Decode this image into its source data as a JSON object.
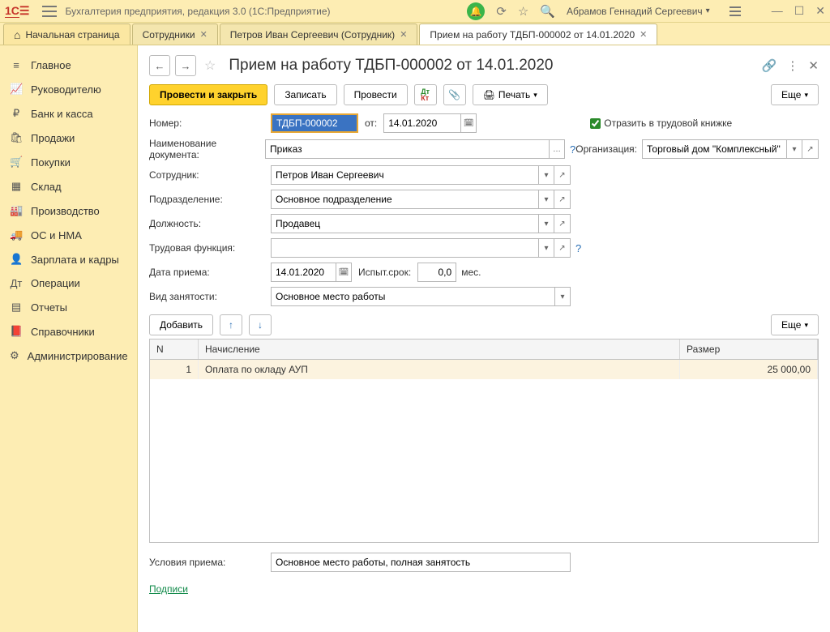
{
  "titlebar": {
    "app_title": "Бухгалтерия предприятия, редакция 3.0  (1С:Предприятие)",
    "username": "Абрамов Геннадий Сергеевич"
  },
  "tabs": {
    "home": "Начальная страница",
    "t1": "Сотрудники",
    "t2": "Петров Иван Сергеевич (Сотрудник)",
    "t3": "Прием на работу ТДБП-000002 от 14.01.2020"
  },
  "sidebar": {
    "items": [
      {
        "icon": "≡",
        "label": "Главное"
      },
      {
        "icon": "📈",
        "label": "Руководителю"
      },
      {
        "icon": "₽",
        "label": "Банк и касса"
      },
      {
        "icon": "🛍",
        "label": "Продажи"
      },
      {
        "icon": "🛒",
        "label": "Покупки"
      },
      {
        "icon": "▦",
        "label": "Склад"
      },
      {
        "icon": "🏭",
        "label": "Производство"
      },
      {
        "icon": "🚚",
        "label": "ОС и НМА"
      },
      {
        "icon": "👤",
        "label": "Зарплата и кадры"
      },
      {
        "icon": "Дт",
        "label": "Операции"
      },
      {
        "icon": "▤",
        "label": "Отчеты"
      },
      {
        "icon": "📕",
        "label": "Справочники"
      },
      {
        "icon": "⚙",
        "label": "Администрирование"
      }
    ]
  },
  "doc": {
    "title": "Прием на работу ТДБП-000002 от 14.01.2020",
    "buttons": {
      "post_close": "Провести и закрыть",
      "save": "Записать",
      "post": "Провести",
      "print": "Печать",
      "more": "Еще"
    },
    "labels": {
      "number": "Номер:",
      "from": "от:",
      "reflect": "Отразить в трудовой книжке",
      "doc_name": "Наименование документа:",
      "org": "Организация:",
      "employee": "Сотрудник:",
      "department": "Подразделение:",
      "position": "Должность:",
      "labor_func": "Трудовая функция:",
      "hire_date": "Дата приема:",
      "trial": "Испыт.срок:",
      "mes": "мес.",
      "emp_type": "Вид занятости:",
      "add": "Добавить",
      "cond": "Условия приема:",
      "signs": "Подписи"
    },
    "values": {
      "number": "ТДБП-000002",
      "date": "14.01.2020",
      "doc_name": "Приказ",
      "org": "Торговый дом \"Комплексный\"",
      "employee": "Петров Иван Сергеевич",
      "department": "Основное подразделение",
      "position": "Продавец",
      "labor_func": "",
      "hire_date": "14.01.2020",
      "trial": "0,0",
      "emp_type": "Основное место работы",
      "cond": "Основное место работы, полная занятость"
    },
    "table": {
      "cols": {
        "n": "N",
        "nazn": "Начисление",
        "raz": "Размер"
      },
      "rows": [
        {
          "n": "1",
          "nazn": "Оплата по окладу АУП",
          "raz": "25 000,00"
        }
      ]
    }
  }
}
